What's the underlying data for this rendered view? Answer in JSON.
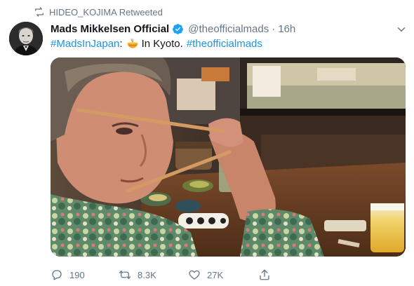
{
  "retweet_header": {
    "label": "HIDEO_KOJIMA Retweeted"
  },
  "author": {
    "display_name": "Mads Mikkelsen Official",
    "handle": "@theofficialmads",
    "separator": "·",
    "time": "16h",
    "avatar_icon": "profile-photo",
    "verified_icon": "verified-badge-icon"
  },
  "tweet": {
    "hashtag_1": "#MadsInJapan",
    "colon": ":",
    "emoji_icon": "ramen-bowl-emoji",
    "text": "In Kyoto.",
    "hashtag_2": "#theofficialmads"
  },
  "media": {
    "icon": "photo"
  },
  "actions": {
    "reply_count": "190",
    "retweet_count": "8.3K",
    "like_count": "27K"
  },
  "colors": {
    "link": "#1b95e0",
    "meta": "#657786",
    "text": "#14171a",
    "verified": "#1da1f2"
  }
}
